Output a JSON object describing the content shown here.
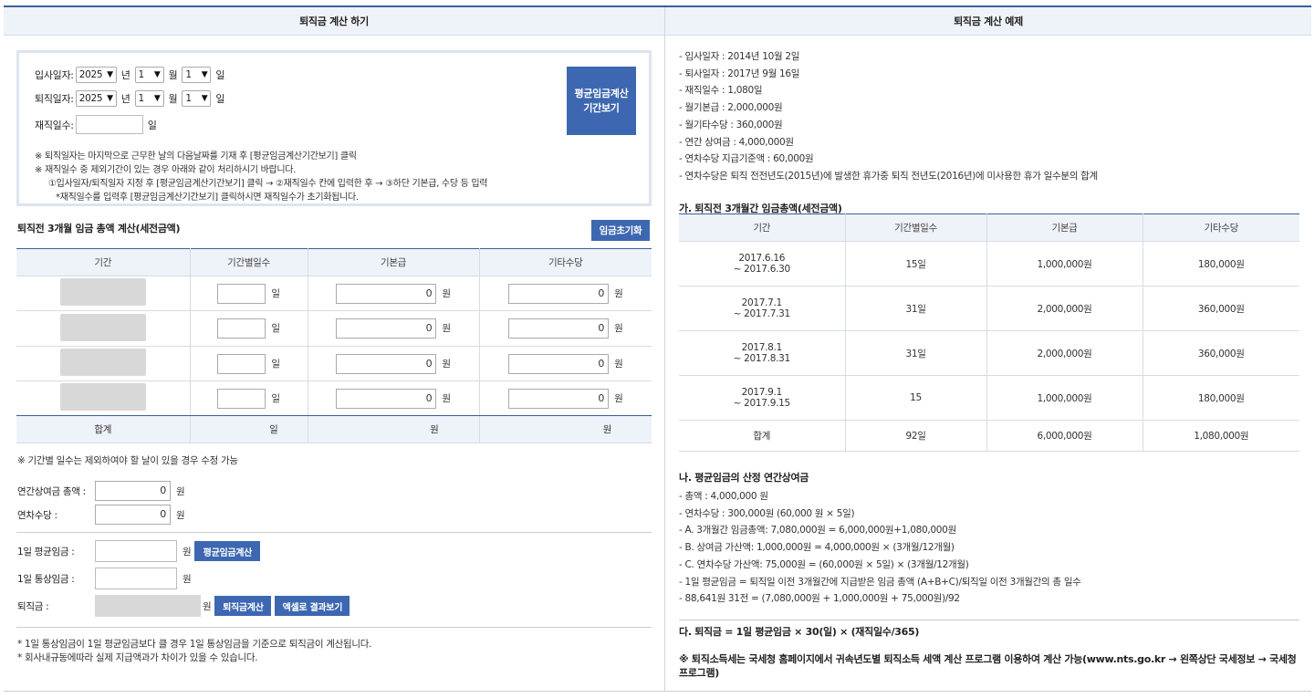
{
  "left": {
    "title": "퇴직금 계산 하기",
    "hire": {
      "label": "입사일자:",
      "year": "2025",
      "month": "1",
      "day": "1"
    },
    "leave": {
      "label": "퇴직일자:",
      "year": "2025",
      "month": "1",
      "day": "1"
    },
    "units": {
      "year": "년",
      "month": "월",
      "day": "일",
      "won": "원"
    },
    "tenure_label": "재직일수:",
    "tenure_unit": "일",
    "period_button": [
      "평균임금계산",
      "기간보기"
    ],
    "notes": [
      "※ 퇴직일자는 마지막으로 근무한 날의 다음날짜를 기재 후 [평균임금계산기간보기] 클릭",
      "※ 재직일수 중 제외기간이 있는 경우 아래와 같이 처리하시기 바랍니다.",
      "①입사일자/퇴직일자 지정 후 [평균임금계산기간보기] 클릭 → ②재직일수 칸에 입력한 후 → ③하단 기본급, 수당 등 입력",
      "*재직일수를 입력후 [평균임금계산기간보기] 클릭하시면 재직일수가 초기화됩니다."
    ],
    "wage_section_title": "퇴직전 3개월 임금 총액 계산(세전금액)",
    "reset_button": "임금초기화",
    "table": {
      "headers": [
        "기간",
        "기간별일수",
        "기본급",
        "기타수당"
      ],
      "rows": [
        {
          "basic": "0",
          "other": "0"
        },
        {
          "basic": "0",
          "other": "0"
        },
        {
          "basic": "0",
          "other": "0"
        },
        {
          "basic": "0",
          "other": "0"
        }
      ],
      "total_label": "합계",
      "total_day_unit": "일",
      "total_basic_unit": "원",
      "total_other_unit": "원"
    },
    "table_note": "※ 기간별 일수는 제외하여야 할 날이 있을 경우 수정 가능",
    "bonus": {
      "label": "연간상여금 총액 :",
      "value": "0"
    },
    "leave_pay": {
      "label": "연차수당 :",
      "value": "0"
    },
    "avg_wage": {
      "label": "1일 평균임금 :",
      "button": "평균임금계산"
    },
    "ordinary_wage": {
      "label": "1일 통상임금 :"
    },
    "severance": {
      "label": "퇴직금 :",
      "calc_button": "퇴직금계산",
      "excel_button": "엑셀로 결과보기"
    },
    "footnotes": [
      "* 1일 통상임금이 1일 평균임금보다 클 경우 1일 통상임금을 기준으로 퇴직금이 계산됩니다.",
      "* 회사내규동에따라 실제 지급액과가 차이가 있을 수 있습니다."
    ]
  },
  "right": {
    "title": "퇴직금 계산 예제",
    "facts": [
      "- 입사일자 : 2014년 10월 2일",
      "- 퇴사일자 : 2017년 9월 16일",
      "- 재직일수 : 1,080일",
      "- 월기본급 : 2,000,000원",
      "- 월기타수당 : 360,000원",
      "- 연간 상여금 : 4,000,000원",
      "- 연차수당 지급기준액 : 60,000원",
      "- 연차수당은 퇴직 전전년도(2015년)에 발생한 휴가중 퇴직 전년도(2016년)에 미사용한 휴가 일수분의 합계"
    ],
    "table_title": "가. 퇴직전 3개월간 임금총액(세전금액)",
    "table": {
      "headers": [
        "기간",
        "기간별일수",
        "기본급",
        "기타수당"
      ],
      "rows": [
        {
          "p1": "2017.6.16",
          "p2": "~ 2017.6.30",
          "days": "15일",
          "basic": "1,000,000원",
          "other": "180,000원"
        },
        {
          "p1": "2017.7.1",
          "p2": "~ 2017.7.31",
          "days": "31일",
          "basic": "2,000,000원",
          "other": "360,000원"
        },
        {
          "p1": "2017.8.1",
          "p2": "~ 2017.8.31",
          "days": "31일",
          "basic": "2,000,000원",
          "other": "360,000원"
        },
        {
          "p1": "2017.9.1",
          "p2": "~ 2017.9.15",
          "days": "15",
          "basic": "1,000,000원",
          "other": "180,000원"
        }
      ],
      "total": {
        "label": "합계",
        "days": "92일",
        "basic": "6,000,000원",
        "other": "1,080,000원"
      }
    },
    "avg_title": "나. 평균임금의 산정 연간상여금",
    "avg_lines": [
      "- 총액 : 4,000,000 원",
      "- 연차수당 : 300,000원 (60,000 원 × 5일)",
      "- A. 3개월간 임금총액: 7,080,000원 = 6,000,000원+1,080,000원",
      "- B. 상여금 가산액: 1,000,000원 = 4,000,000원 × (3개월/12개월)",
      "- C. 연차수당 가산액: 75,000원 = (60,000원 × 5일) × (3개월/12개월)",
      "- 1일 평균임금 = 퇴직일 이전 3개월간에 지급받은 임금 총액 (A+B+C)/퇴직일 이전 3개월간의 총 일수",
      "- 88,641원 31전 = (7,080,000원 + 1,000,000원 + 75,000원)/92"
    ],
    "formula_title": "다. 퇴직금 = 1일 평균임금 × 30(일) × (재직일수/365)",
    "tax_note_1": "※ 퇴직소득세는 국세청 홈페이지에서 귀속년도별 퇴직소득 세액 계산 프로그램 이용하여 계산 가능(www.nts.go.kr → 왼쪽상단 국세정보 → 국세청",
    "tax_note_2": "프로그램)"
  }
}
